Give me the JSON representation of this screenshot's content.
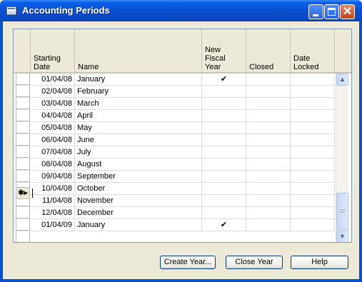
{
  "window": {
    "title": "Accounting Periods",
    "minimize_glyph": "",
    "maximize_glyph": "",
    "close_glyph": "✕"
  },
  "table": {
    "columns": [
      "Starting\nDate",
      "Name",
      "New Fiscal\nYear",
      "Closed",
      "Date\nLocked"
    ],
    "rows": [
      {
        "date": "01/04/08",
        "name": "January",
        "new_fiscal_year": "✔",
        "closed": "",
        "locked": ""
      },
      {
        "date": "02/04/08",
        "name": "February",
        "new_fiscal_year": "",
        "closed": "",
        "locked": ""
      },
      {
        "date": "03/04/08",
        "name": "March",
        "new_fiscal_year": "",
        "closed": "",
        "locked": ""
      },
      {
        "date": "04/04/08",
        "name": "April",
        "new_fiscal_year": "",
        "closed": "",
        "locked": ""
      },
      {
        "date": "05/04/08",
        "name": "May",
        "new_fiscal_year": "",
        "closed": "",
        "locked": ""
      },
      {
        "date": "06/04/08",
        "name": "June",
        "new_fiscal_year": "",
        "closed": "",
        "locked": ""
      },
      {
        "date": "07/04/08",
        "name": "July",
        "new_fiscal_year": "",
        "closed": "",
        "locked": ""
      },
      {
        "date": "08/04/08",
        "name": "August",
        "new_fiscal_year": "",
        "closed": "",
        "locked": ""
      },
      {
        "date": "09/04/08",
        "name": "September",
        "new_fiscal_year": "",
        "closed": "",
        "locked": ""
      },
      {
        "date": "10/04/08",
        "name": "October",
        "new_fiscal_year": "",
        "closed": "",
        "locked": ""
      },
      {
        "date": "11/04/08",
        "name": "November",
        "new_fiscal_year": "",
        "closed": "",
        "locked": ""
      },
      {
        "date": "12/04/08",
        "name": "December",
        "new_fiscal_year": "",
        "closed": "",
        "locked": ""
      },
      {
        "date": "01/04/09",
        "name": "January",
        "new_fiscal_year": "✔",
        "closed": "",
        "locked": ""
      }
    ],
    "new_row_marker": "✱▸"
  },
  "scrollbar": {
    "up": "▲",
    "down": "▼"
  },
  "buttons": {
    "create_year": "Create Year...",
    "close_year": "Close Year",
    "help": "Help"
  },
  "colors": {
    "titlebar": "#0a4fd0",
    "window_bg": "#ece9d8",
    "close_button": "#c4441e"
  }
}
